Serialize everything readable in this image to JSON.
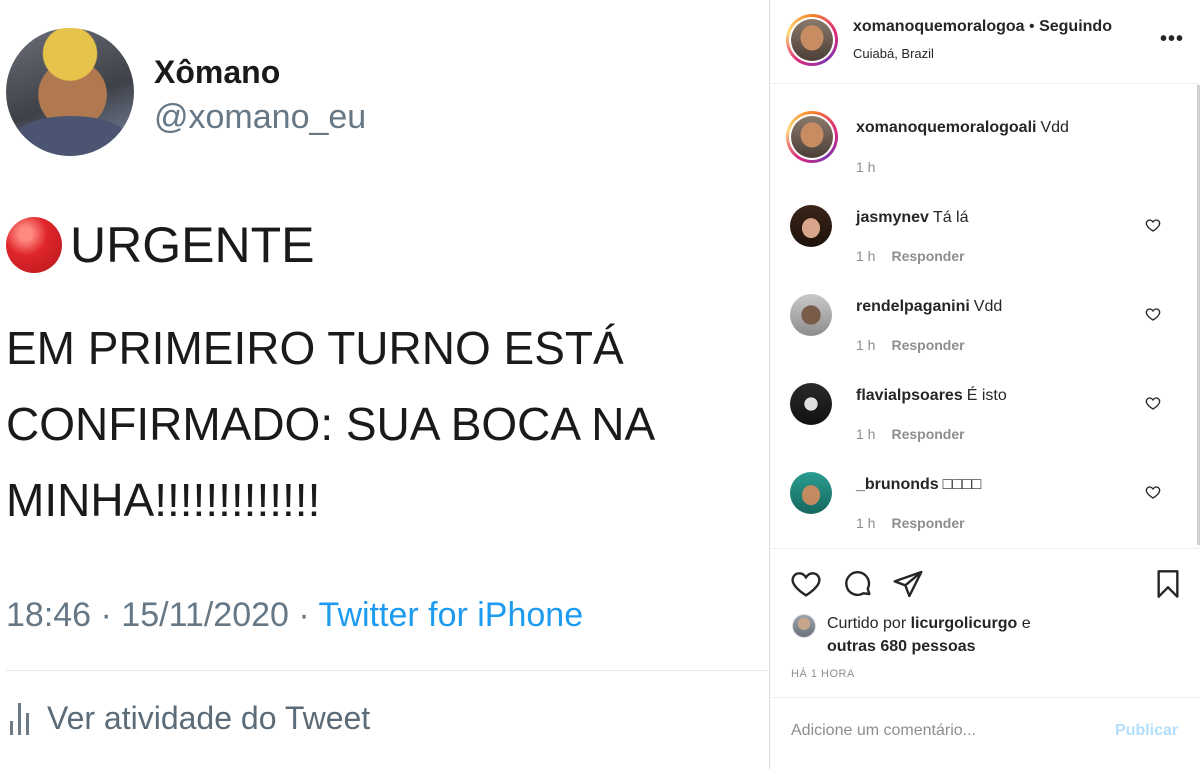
{
  "tweet": {
    "display_name": "Xômano",
    "handle": "@xomano_eu",
    "headline": "URGENTE",
    "body": "EM PRIMEIRO TURNO ESTÁ CONFIRMADO: SUA BOCA NA MINHA!!!!!!!!!!!!!",
    "time": "18:46 · 15/11/2020 · ",
    "source": "Twitter for iPhone",
    "activity_label": "Ver atividade do Tweet",
    "icons": {
      "headline": "red-circle-emoji",
      "activity": "bar-chart-icon"
    }
  },
  "instagram": {
    "header": {
      "username": "xomanoquemoralogoa",
      "separator": " • ",
      "follow_status": "Seguindo",
      "location": "Cuiabá, Brazil",
      "more_label": "•••"
    },
    "caption": {
      "username": "xomanoquemoralogoali",
      "text": "Vdd",
      "time": "1 h"
    },
    "comments": [
      {
        "username": "jasmynev",
        "text": "Tá lá",
        "time": "1 h",
        "reply": "Responder"
      },
      {
        "username": "rendelpaganini",
        "text": "Vdd",
        "time": "1 h",
        "reply": "Responder"
      },
      {
        "username": "flavialpsoares",
        "text": "É isto",
        "time": "1 h",
        "reply": "Responder"
      },
      {
        "username": "_brunonds",
        "text": "□□□□",
        "time": "1 h",
        "reply": "Responder"
      }
    ],
    "likes": {
      "prefix": "Curtido por ",
      "user": "licurgolicurgo",
      "mid": " e",
      "others": "outras 680 pessoas"
    },
    "time_ago": "HÁ 1 HORA",
    "add_comment": {
      "placeholder": "Adicione um comentário...",
      "publish_label": "Publicar"
    },
    "colors": {
      "accent_disabled": "#b2dffc",
      "secondary_text": "#8e8e8e",
      "link_blue": "#1d9bf0"
    }
  }
}
